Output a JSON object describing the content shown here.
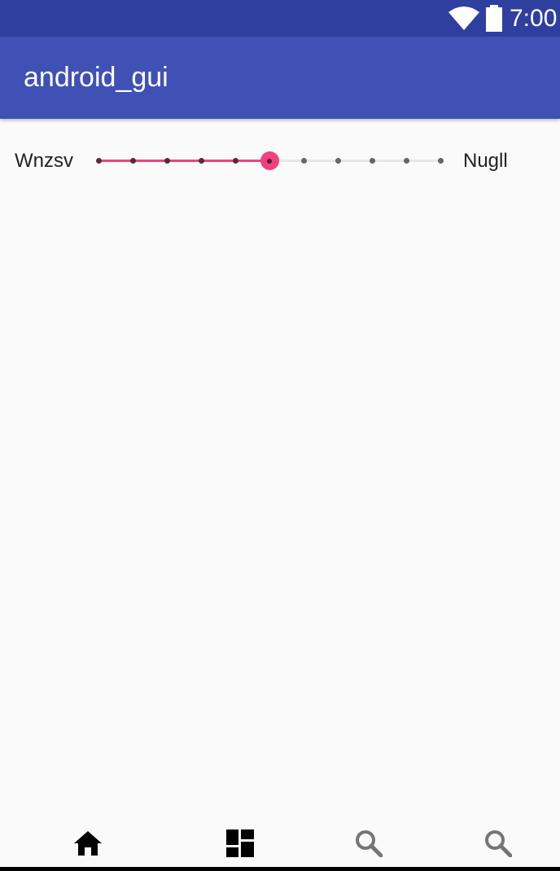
{
  "status_bar": {
    "time": "7:00",
    "icons": [
      "wifi-icon",
      "battery-icon"
    ],
    "background": "#2e3f9f"
  },
  "app_bar": {
    "title": "android_gui",
    "background": "#3f51b5"
  },
  "slider": {
    "left_label": "Wnzsv",
    "right_label": "Nugll",
    "steps": 10,
    "value": 5,
    "accent_color": "#f0407f"
  },
  "bottom_nav": {
    "items": [
      {
        "icon": "home-icon",
        "active": true
      },
      {
        "icon": "dashboard-icon",
        "active": false
      },
      {
        "icon": "search-icon",
        "active": false
      },
      {
        "icon": "search-icon",
        "active": false
      }
    ]
  }
}
